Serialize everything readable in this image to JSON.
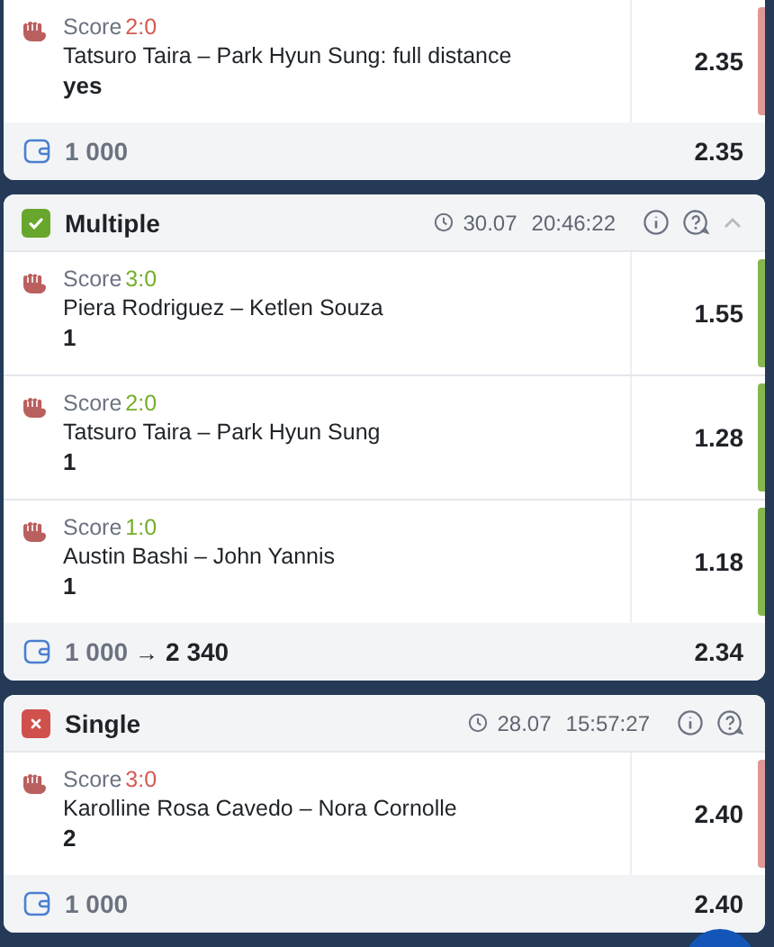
{
  "bets": [
    {
      "events": [
        {
          "score_label": "Score",
          "score": "2:0",
          "won": false,
          "name": "Tatsuro Taira – Park Hyun Sung: full distance",
          "pick": "yes",
          "odds": "2.35"
        }
      ],
      "footer": {
        "stake": "1 000",
        "odds": "2.35"
      }
    },
    {
      "header": {
        "title": "Multiple",
        "won": true,
        "date": "30.07",
        "time": "20:46:22",
        "expanded": true
      },
      "events": [
        {
          "score_label": "Score",
          "score": "3:0",
          "won": true,
          "name": "Piera Rodriguez – Ketlen Souza",
          "pick": "1",
          "odds": "1.55"
        },
        {
          "score_label": "Score",
          "score": "2:0",
          "won": true,
          "name": "Tatsuro Taira – Park Hyun Sung",
          "pick": "1",
          "odds": "1.28"
        },
        {
          "score_label": "Score",
          "score": "1:0",
          "won": true,
          "name": "Austin Bashi – John Yannis",
          "pick": "1",
          "odds": "1.18"
        }
      ],
      "footer": {
        "stake": "1 000",
        "arrow": "→",
        "payout": "2 340",
        "odds": "2.34"
      }
    },
    {
      "header": {
        "title": "Single",
        "won": false,
        "date": "28.07",
        "time": "15:57:27"
      },
      "events": [
        {
          "score_label": "Score",
          "score": "3:0",
          "won": false,
          "name": "Karolline Rosa Cavedo – Nora Cornolle",
          "pick": "2",
          "odds": "2.40"
        }
      ],
      "footer": {
        "stake": "1 000",
        "odds": "2.40"
      }
    }
  ]
}
